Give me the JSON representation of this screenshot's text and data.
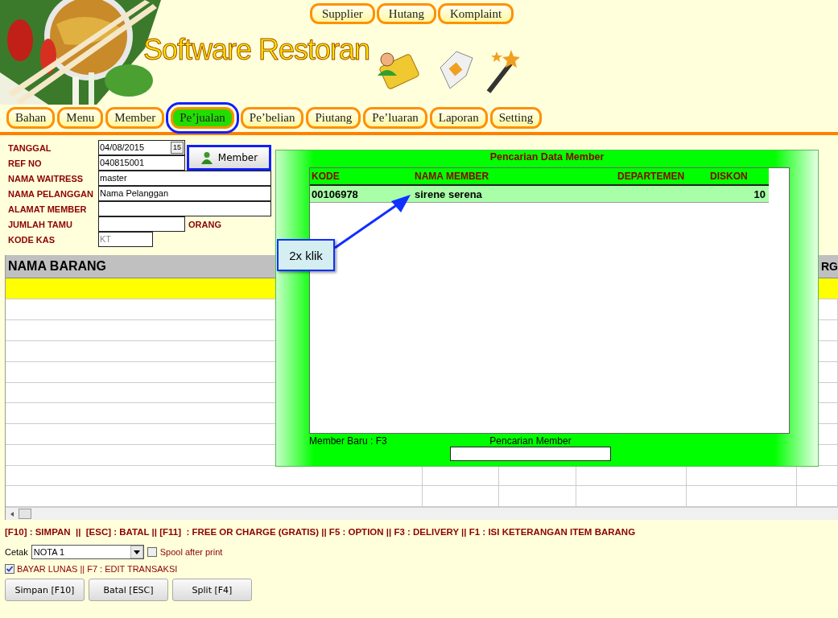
{
  "header": {
    "title": "Software Restoran",
    "top_buttons": [
      "Supplier",
      "Hutang",
      "Komplaint"
    ]
  },
  "nav": [
    {
      "label": "Bahan",
      "selected": false
    },
    {
      "label": "Menu",
      "selected": false
    },
    {
      "label": "Member",
      "selected": false
    },
    {
      "label": "Pe’jualan",
      "selected": true
    },
    {
      "label": "Pe’belian",
      "selected": false
    },
    {
      "label": "Piutang",
      "selected": false
    },
    {
      "label": "Pe’luaran",
      "selected": false
    },
    {
      "label": "Laporan",
      "selected": false
    },
    {
      "label": "Setting",
      "selected": false
    }
  ],
  "form": {
    "fields": [
      {
        "label": "TANGGAL",
        "value": "04/08/2015",
        "kind": "date",
        "icon_text": "15"
      },
      {
        "label": "REF NO",
        "value": "040815001",
        "kind": "short"
      },
      {
        "label": "NAMA WAITRESS",
        "value": "master",
        "kind": "wide"
      },
      {
        "label": "NAMA PELANGGAN",
        "value": "Nama Pelanggan",
        "kind": "wide"
      },
      {
        "label": "ALAMAT MEMBER",
        "kind": "wide"
      },
      {
        "label": "JUMLAH TAMU",
        "kind": "count",
        "unit": "ORANG"
      },
      {
        "label": "KODE KAS",
        "placeholder": "KT",
        "kind": "code"
      }
    ],
    "member_button": "Member"
  },
  "grid": {
    "columns": [
      "NAMA BARANG",
      "RG"
    ]
  },
  "hotkeys": "[F10] : SIMPAN  ||  [ESC] : BATAL || [F11]  : FREE OR CHARGE (GRATIS) || F5 : OPTION || F3 : DELIVERY || F1 : ISI KETERANGAN ITEM BARANG",
  "print": {
    "label": "Cetak",
    "value": "NOTA 1",
    "spool": {
      "label": "Spool after print",
      "checked": false
    }
  },
  "paid": {
    "label": "BAYAR LUNAS || F7 : EDIT TRANSAKSI",
    "checked": true
  },
  "buttons": [
    "Simpan [F10]",
    "Batal [ESC]",
    "Split [F4]"
  ],
  "dialog": {
    "title": "Pencarian Data Member",
    "columns": [
      "KODE",
      "NAMA MEMBER",
      "DEPARTEMEN",
      "DISKON"
    ],
    "rows": [
      {
        "kode": "00106978",
        "nama": "sirene serena",
        "diskon": "10",
        "selected": true
      }
    ],
    "new_hint": "Member Baru : F3",
    "search_label": "Pencarian Member"
  },
  "callout": "2x klik"
}
